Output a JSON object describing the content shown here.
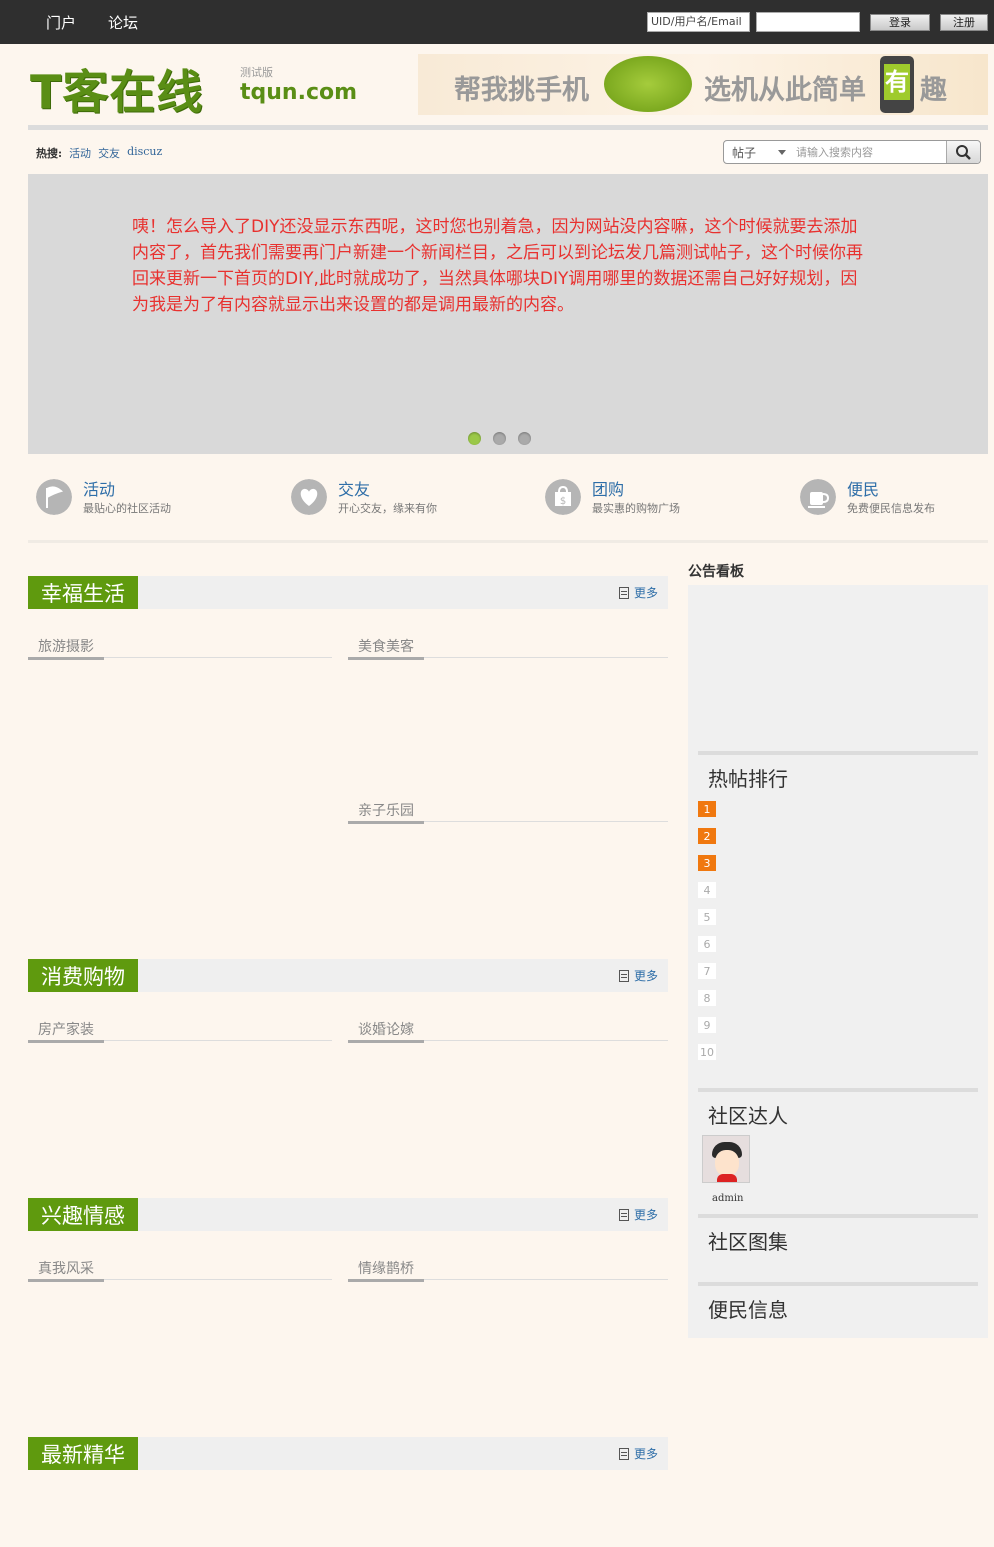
{
  "topnav": [
    "门户",
    "论坛"
  ],
  "login": {
    "user_placeholder": "UID/用户名/Email",
    "login_label": "登录",
    "register_label": "注册"
  },
  "logo": {
    "main": "T客在线",
    "sub": "测试版",
    "domain": "tqun.com"
  },
  "banner": {
    "text1": "帮我挑手机",
    "text2": "选机从此简单",
    "highlight": "有",
    "text3": "趣"
  },
  "hot": {
    "label": "热搜:",
    "links": [
      "活动",
      "交友",
      "discuz"
    ]
  },
  "search": {
    "type": "帖子",
    "placeholder": "请输入搜索内容"
  },
  "slider": {
    "message": "咦！怎么导入了DIY还没显示东西呢，这时您也别着急，因为网站没内容嘛，这个时候就要去添加内容了，首先我们需要再门户新建一个新闻栏目，之后可以到论坛发几篇测试帖子，这个时候你再回来更新一下首页的DIY,此时就成功了，当然具体哪块DIY调用哪里的数据还需自己好好规划，因为我是为了有内容就显示出来设置的都是调用最新的内容。"
  },
  "features": [
    {
      "title": "活动",
      "desc": "最贴心的社区活动",
      "icon": "flag-icon"
    },
    {
      "title": "交友",
      "desc": "开心交友，缘来有你",
      "icon": "heart-icon"
    },
    {
      "title": "团购",
      "desc": "最实惠的购物广场",
      "icon": "shopping-bag-icon"
    },
    {
      "title": "便民",
      "desc": "免费便民信息发布",
      "icon": "coffee-cup-icon"
    }
  ],
  "sections": [
    {
      "title": "幸福生活",
      "more": "更多",
      "subs": [
        "旅游摄影",
        "美食美客",
        "亲子乐园"
      ]
    },
    {
      "title": "消费购物",
      "more": "更多",
      "subs": [
        "房产家装",
        "谈婚论嫁"
      ]
    },
    {
      "title": "兴趣情感",
      "more": "更多",
      "subs": [
        "真我风采",
        "情缘鹊桥"
      ]
    },
    {
      "title": "最新精华",
      "more": "更多",
      "subs": []
    }
  ],
  "side": {
    "notice": "公告看板",
    "hot_rank": "热帖排行",
    "ranks": [
      "1",
      "2",
      "3",
      "4",
      "5",
      "6",
      "7",
      "8",
      "9",
      "10"
    ],
    "stars": "社区达人",
    "username": "admin",
    "album": "社区图集",
    "info": "便民信息"
  },
  "colors": {
    "brand_green": "#5f9a0e",
    "rank_orange": "#f0780f",
    "slider_text": "#e8312f",
    "link_blue": "#2e6ea8"
  }
}
